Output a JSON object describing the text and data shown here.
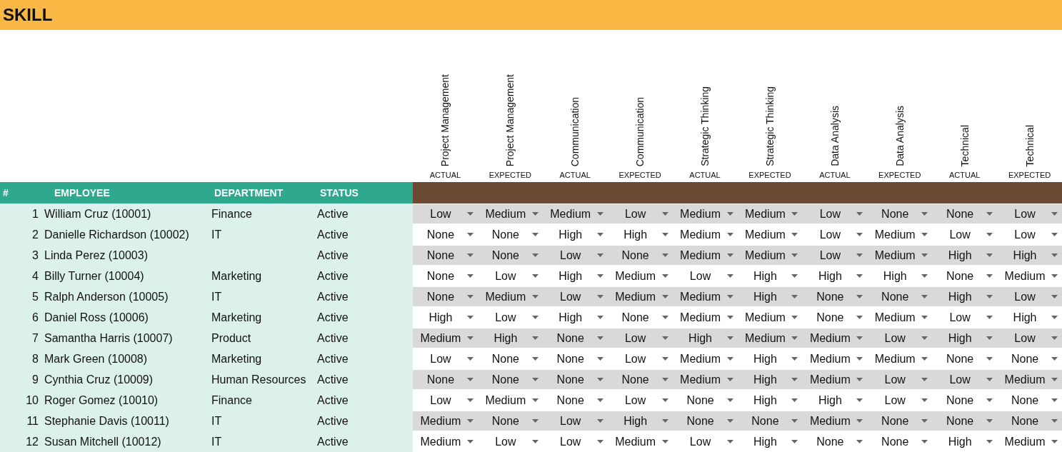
{
  "title": "SKILL",
  "skill_columns": [
    {
      "skill": "Project Management",
      "type": "ACTUAL"
    },
    {
      "skill": "Project Management",
      "type": "EXPECTED"
    },
    {
      "skill": "Communication",
      "type": "ACTUAL"
    },
    {
      "skill": "Communication",
      "type": "EXPECTED"
    },
    {
      "skill": "Strategic Thinking",
      "type": "ACTUAL"
    },
    {
      "skill": "Strategic Thinking",
      "type": "EXPECTED"
    },
    {
      "skill": "Data Analysis",
      "type": "ACTUAL"
    },
    {
      "skill": "Data Analysis",
      "type": "EXPECTED"
    },
    {
      "skill": "Technical",
      "type": "ACTUAL"
    },
    {
      "skill": "Technical",
      "type": "EXPECTED"
    }
  ],
  "columns": [
    "#",
    "EMPLOYEE",
    "DEPARTMENT",
    "STATUS"
  ],
  "rows": [
    {
      "number": "1",
      "employee": "William Cruz (10001)",
      "department": "Finance",
      "status": "Active",
      "skills": [
        "Low",
        "Medium",
        "Medium",
        "Low",
        "Medium",
        "Medium",
        "Low",
        "None",
        "None",
        "Low"
      ]
    },
    {
      "number": "2",
      "employee": "Danielle Richardson (10002)",
      "department": "IT",
      "status": "Active",
      "skills": [
        "None",
        "None",
        "High",
        "High",
        "Medium",
        "Medium",
        "Low",
        "Medium",
        "Low",
        "Low"
      ]
    },
    {
      "number": "3",
      "employee": "Linda Perez (10003)",
      "status": "Active",
      "skills": [
        "None",
        "None",
        "Low",
        "None",
        "Medium",
        "Medium",
        "Low",
        "Medium",
        "High",
        "High"
      ]
    },
    {
      "number": "4",
      "employee": "Billy Turner (10004)",
      "department": "Marketing",
      "status": "Active",
      "skills": [
        "None",
        "Low",
        "High",
        "Medium",
        "Low",
        "High",
        "High",
        "High",
        "None",
        "Medium"
      ]
    },
    {
      "number": "5",
      "employee": "Ralph Anderson (10005)",
      "department": "IT",
      "status": "Active",
      "skills": [
        "None",
        "Medium",
        "Low",
        "Medium",
        "Medium",
        "High",
        "None",
        "None",
        "High",
        "Low"
      ]
    },
    {
      "number": "6",
      "employee": "Daniel Ross (10006)",
      "department": "Marketing",
      "status": "Active",
      "skills": [
        "High",
        "Low",
        "High",
        "None",
        "Medium",
        "Medium",
        "None",
        "Medium",
        "Low",
        "High"
      ]
    },
    {
      "number": "7",
      "employee": "Samantha Harris (10007)",
      "department": "Product",
      "status": "Active",
      "skills": [
        "Medium",
        "High",
        "None",
        "Low",
        "High",
        "Medium",
        "Medium",
        "Low",
        "High",
        "Low"
      ]
    },
    {
      "number": "8",
      "employee": "Mark Green (10008)",
      "department": "Marketing",
      "status": "Active",
      "skills": [
        "Low",
        "None",
        "None",
        "Low",
        "Medium",
        "High",
        "Medium",
        "Medium",
        "None",
        "None"
      ]
    },
    {
      "number": "9",
      "employee": "Cynthia Cruz (10009)",
      "department": "Human Resources",
      "status": "Active",
      "skills": [
        "None",
        "None",
        "None",
        "None",
        "Medium",
        "High",
        "Medium",
        "Low",
        "Low",
        "Medium"
      ]
    },
    {
      "number": "10",
      "employee": "Roger Gomez (10010)",
      "department": "Finance",
      "status": "Active",
      "skills": [
        "Low",
        "Medium",
        "None",
        "Low",
        "None",
        "High",
        "High",
        "Low",
        "None",
        "None"
      ]
    },
    {
      "number": "11",
      "employee": "Stephanie Davis (10011)",
      "department": "IT",
      "status": "Active",
      "skills": [
        "Medium",
        "None",
        "Low",
        "High",
        "None",
        "None",
        "Medium",
        "None",
        "None",
        "None"
      ]
    },
    {
      "number": "12",
      "employee": "Susan Mitchell (10012)",
      "department": "IT",
      "status": "Active",
      "skills": [
        "Medium",
        "Low",
        "Low",
        "Medium",
        "Low",
        "High",
        "None",
        "None",
        "High",
        "Medium"
      ]
    }
  ]
}
